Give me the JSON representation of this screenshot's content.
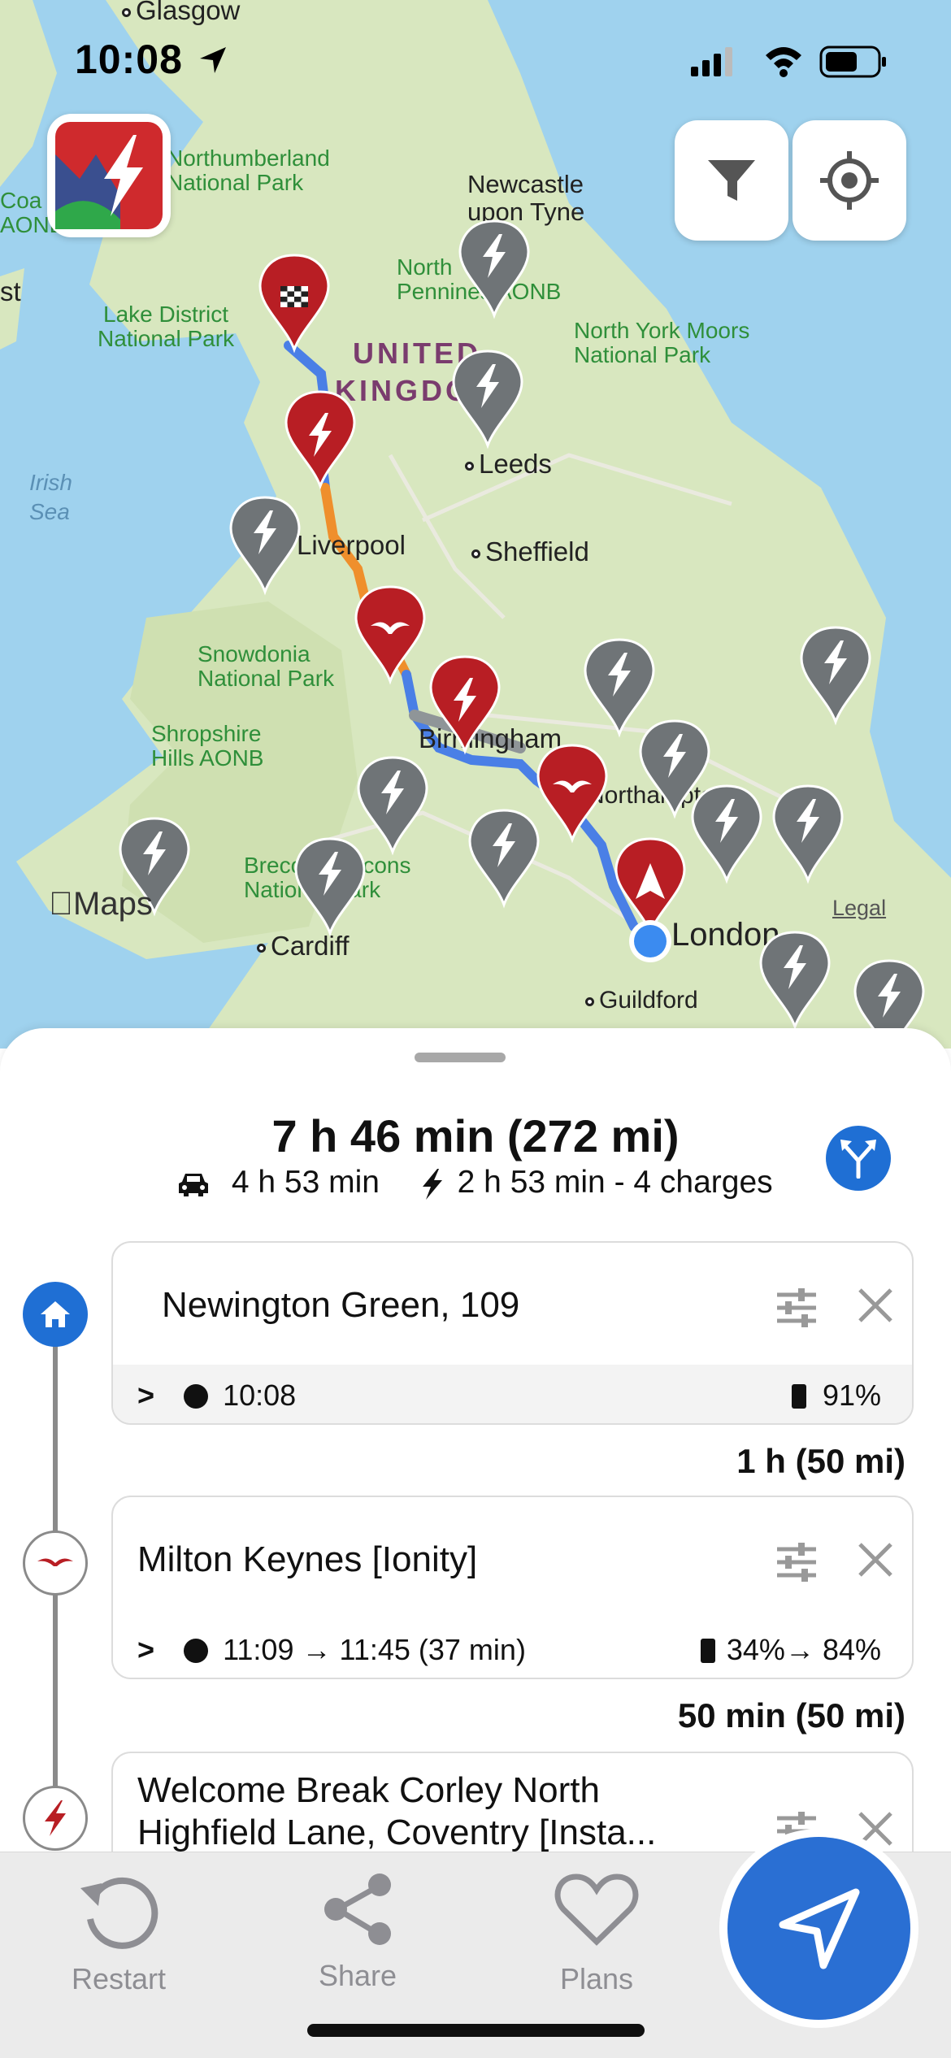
{
  "status_bar": {
    "time": "10:08"
  },
  "map": {
    "attribution": "Maps",
    "legal": "Legal",
    "labels": {
      "glasgow": "Glasgow",
      "northumberland": "Northumberland\nNational Park",
      "coast": "Coa\nAONB",
      "newcastle": "Newcastle\nupon Tyne",
      "north_pennines": "North\nPennines AONB",
      "lake_district": "Lake District\nNational Park",
      "north_york": "North York Moors\nNational Park",
      "country": "UNITED\nKINGDOM",
      "irish_sea": "Irish\nSea",
      "leeds": "Leeds",
      "liverpool": "Liverpool",
      "sheffield": "Sheffield",
      "snowdonia": "Snowdonia\nNational Park",
      "shropshire": "Shropshire\nHills AONB",
      "birmingham": "Birmingham",
      "northampton": "Northampton",
      "brecon": "Brecon Beacons\nNational Park",
      "cardiff": "Cardiff",
      "london": "London",
      "guildford": "Guildford",
      "st": "st"
    }
  },
  "route_summary": {
    "total": "7 h 46 min (272 mi)",
    "drive": "4 h 53 min",
    "charge": "2 h 53 min - 4 charges"
  },
  "stops": [
    {
      "name": "Newington Green, 109",
      "time": "10:08",
      "battery": "91%"
    },
    {
      "name": "Milton Keynes [Ionity]",
      "time": "11:09 → 11:45 (37 min)",
      "battery": "34%→ 84%"
    },
    {
      "name": "Welcome Break Corley North\nHighfield Lane, Coventry [Insta..."
    }
  ],
  "segments": [
    "1 h (50 mi)",
    "50 min (50 mi)"
  ],
  "tabbar": {
    "restart": "Restart",
    "share": "Share",
    "plans": "Plans"
  },
  "colors": {
    "accent": "#1f6fd4",
    "marker_red": "#b81e24",
    "marker_gray": "#6f7477",
    "route_blue": "#4a7fe6",
    "route_orange": "#ef8f2c"
  }
}
